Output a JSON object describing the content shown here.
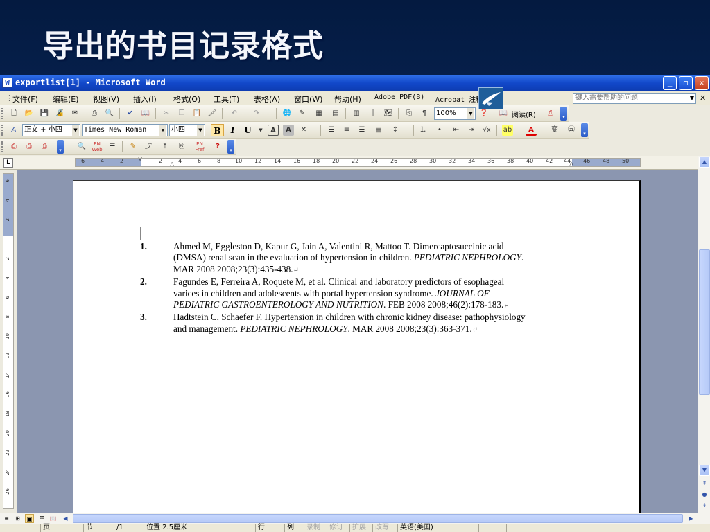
{
  "slide": {
    "title": "导出的书目记录格式"
  },
  "window": {
    "title": "exportlist[1] - Microsoft Word",
    "app_icon": "W",
    "controls": {
      "minimize": "_",
      "maximize": "❐",
      "close": "✕"
    }
  },
  "menubar": {
    "items": [
      "文件(F)",
      "编辑(E)",
      "视图(V)",
      "插入(I)",
      "格式(O)",
      "工具(T)",
      "表格(A)",
      "窗口(W)",
      "帮助(H)",
      "Adobe PDF(B)",
      "Acrobat 注释"
    ],
    "help_placeholder": "键入需要帮助的问题",
    "doc_close": "✕"
  },
  "toolbar_standard": {
    "zoom": "100%",
    "reading_label": "阅读(R)"
  },
  "toolbar_formatting": {
    "style": "正文 + 小四",
    "font": "Times New Roman",
    "size": "小四",
    "bold": "B",
    "italic": "I",
    "underline": "U"
  },
  "toolbar_third": {
    "en_web": "EN Web",
    "en_fref": "EN Fref",
    "help": "?"
  },
  "ruler": {
    "corner": "L",
    "ticks": [
      "6",
      "4",
      "2",
      "",
      "2",
      "4",
      "6",
      "8",
      "10",
      "12",
      "14",
      "16",
      "18",
      "20",
      "22",
      "24",
      "26",
      "28",
      "30",
      "32",
      "34",
      "36",
      "38",
      "40",
      "42",
      "44",
      "46",
      "48",
      "50"
    ],
    "vticks": [
      "6",
      "4",
      "2",
      "",
      "2",
      "4",
      "6",
      "8",
      "10",
      "12",
      "14",
      "16",
      "18",
      "20",
      "22",
      "24",
      "26"
    ]
  },
  "document": {
    "references": [
      {
        "num": "1.",
        "text": "Ahmed M, Eggleston D, Kapur G, Jain A, Valentini R, Mattoo T. Dimercaptosuccinic acid (DMSA) renal scan in the evaluation of hypertension in children. ",
        "journal": "PEDIATRIC NEPHROLOGY",
        "rest": ". MAR 2008 2008;23(3):435-438."
      },
      {
        "num": "2.",
        "text": "Fagundes E, Ferreira A, Roquete M, et al. Clinical and laboratory predictors of esophageal varices in children and adolescents with portal hypertension syndrome. ",
        "journal": "JOURNAL OF PEDIATRIC GASTROENTEROLOGY AND NUTRITION",
        "rest": ". FEB 2008 2008;46(2):178-183."
      },
      {
        "num": "3.",
        "text": "Hadtstein C, Schaefer F. Hypertension in children with chronic kidney disease: pathophysiology and management. ",
        "journal": "PEDIATRIC NEPHROLOGY",
        "rest": ". MAR 2008 2008;23(3):363-371."
      }
    ],
    "para_mark": "↵"
  },
  "statusbar": {
    "page": "页",
    "section": "节",
    "page_count": "/1",
    "position": "位置 2.5厘米",
    "line": "行",
    "column": "列",
    "rec": "录制",
    "trk": "修订",
    "ext": "扩展",
    "ovr": "改写",
    "language": "英语(美国)"
  }
}
